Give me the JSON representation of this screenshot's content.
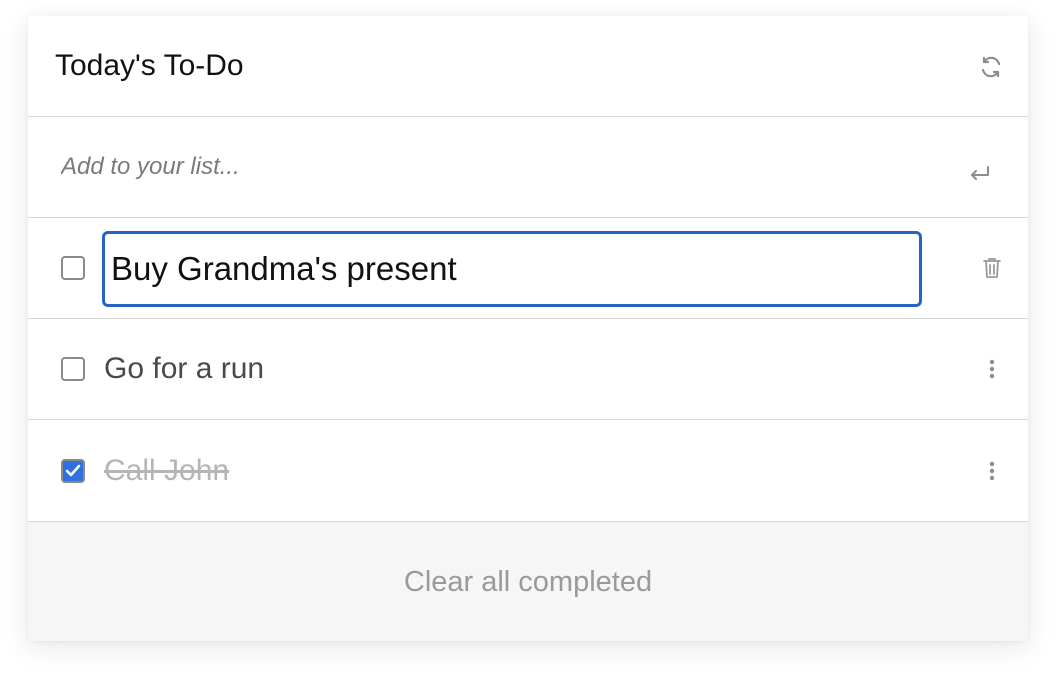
{
  "header": {
    "title": "Today's To-Do",
    "refresh_icon": "refresh-icon"
  },
  "add_item": {
    "placeholder": "Add to your list...",
    "value": "",
    "enter_icon": "enter-return-icon"
  },
  "items": [
    {
      "text": "Buy Grandma's present",
      "completed": false,
      "editing": true,
      "action_icon": "trash-icon"
    },
    {
      "text": "Go for a run",
      "completed": false,
      "editing": false,
      "action_icon": "more-vertical-icon"
    },
    {
      "text": "Call John",
      "completed": true,
      "editing": false,
      "action_icon": "more-vertical-icon"
    }
  ],
  "footer": {
    "clear_label": "Clear all completed"
  },
  "colors": {
    "accent": "#2f6fde",
    "edit_border": "#2563c7",
    "completed_text": "#b5b5b5",
    "footer_bg": "#f6f6f6"
  }
}
